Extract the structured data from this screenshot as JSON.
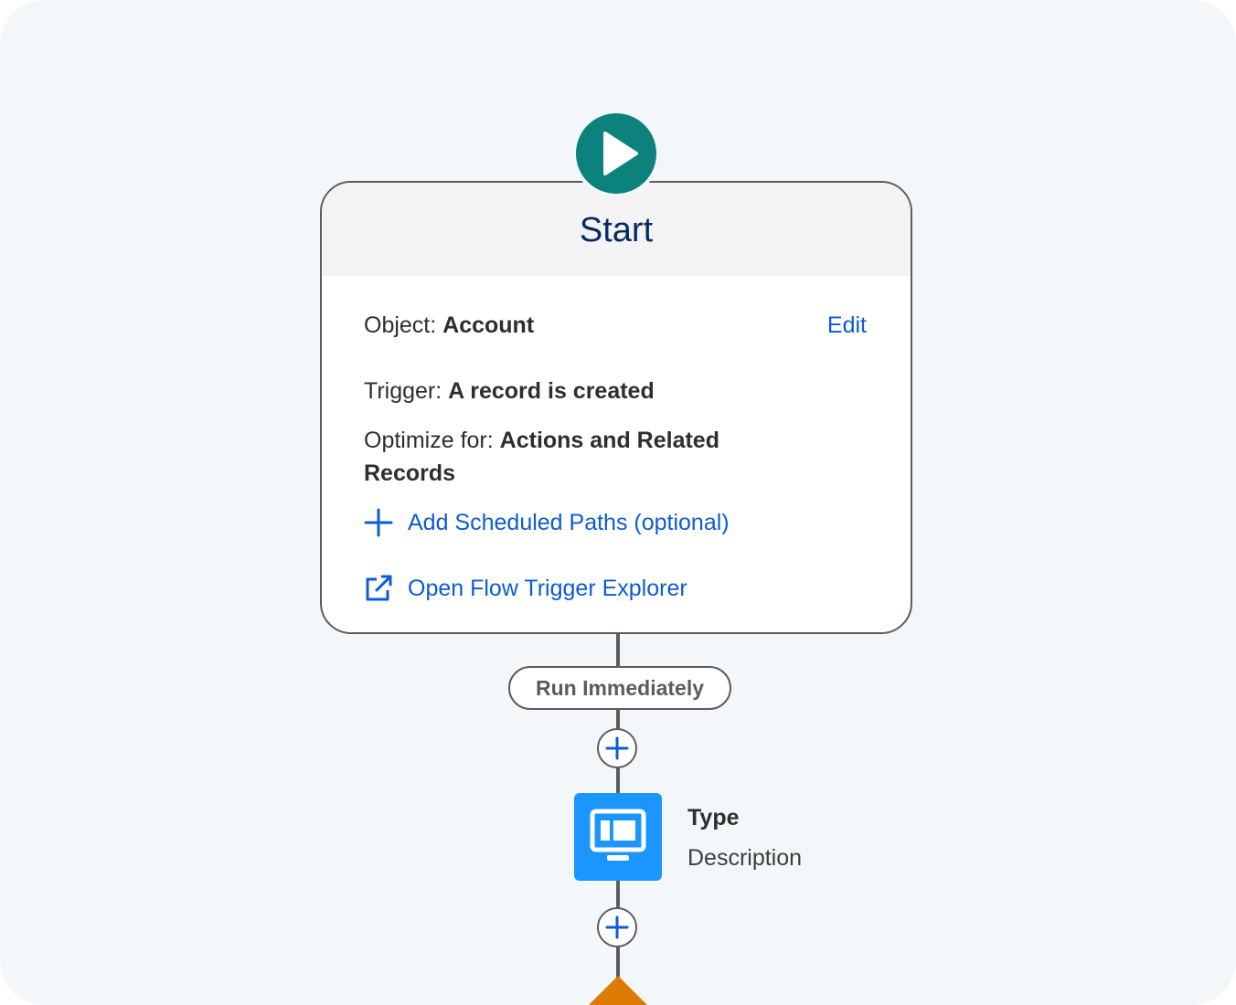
{
  "start": {
    "title": "Start",
    "object_label": "Object:",
    "object_value": "Account",
    "edit_label": "Edit",
    "trigger_label": "Trigger:",
    "trigger_value": "A record is created",
    "optimize_label": "Optimize for:",
    "optimize_value_line1": "Actions and Related",
    "optimize_value_line2": "Records",
    "add_paths_label": "Add Scheduled Paths (optional)",
    "explorer_label": "Open Flow Trigger Explorer"
  },
  "path": {
    "pill_label": "Run Immediately"
  },
  "element": {
    "type_label": "Type",
    "description": "Description"
  },
  "colors": {
    "start_icon": "#0b827c",
    "link": "#0b5cd5",
    "screen_tile": "#1b96ff",
    "decision": "#dd7a01",
    "heading": "#032d60"
  },
  "icons": {
    "start": "play-icon",
    "add_paths": "plus-icon",
    "explorer": "external-link-icon",
    "element": "screen-icon",
    "add_element": "plus-icon",
    "decision": "diamond-icon"
  }
}
